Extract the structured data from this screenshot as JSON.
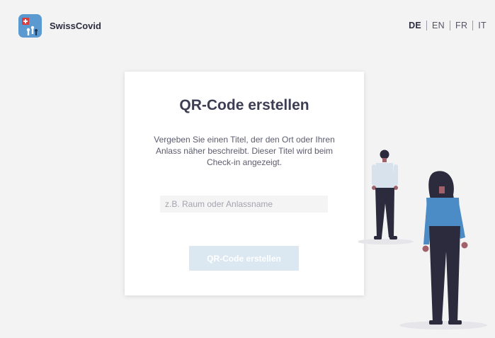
{
  "header": {
    "brand": "SwissCovid",
    "languages": [
      {
        "code": "DE",
        "active": true
      },
      {
        "code": "EN",
        "active": false
      },
      {
        "code": "FR",
        "active": false
      },
      {
        "code": "IT",
        "active": false
      }
    ]
  },
  "card": {
    "title": "QR-Code erstellen",
    "description": "Vergeben Sie einen Titel, der den Ort oder Ihren Anlass näher beschreibt. Dieser Titel wird beim Check-in angezeigt.",
    "input": {
      "placeholder": "z.B. Raum oder Anlassname",
      "value": ""
    },
    "button_label": "QR-Code erstellen"
  },
  "colors": {
    "background": "#f3f3f3",
    "title": "#3d3d54",
    "button_disabled": "#dbe8f1",
    "logo": "#5a9ad0",
    "figure_jacket": "#4b8cc7"
  },
  "icons": {
    "logo": "swisscovid-app-icon"
  }
}
